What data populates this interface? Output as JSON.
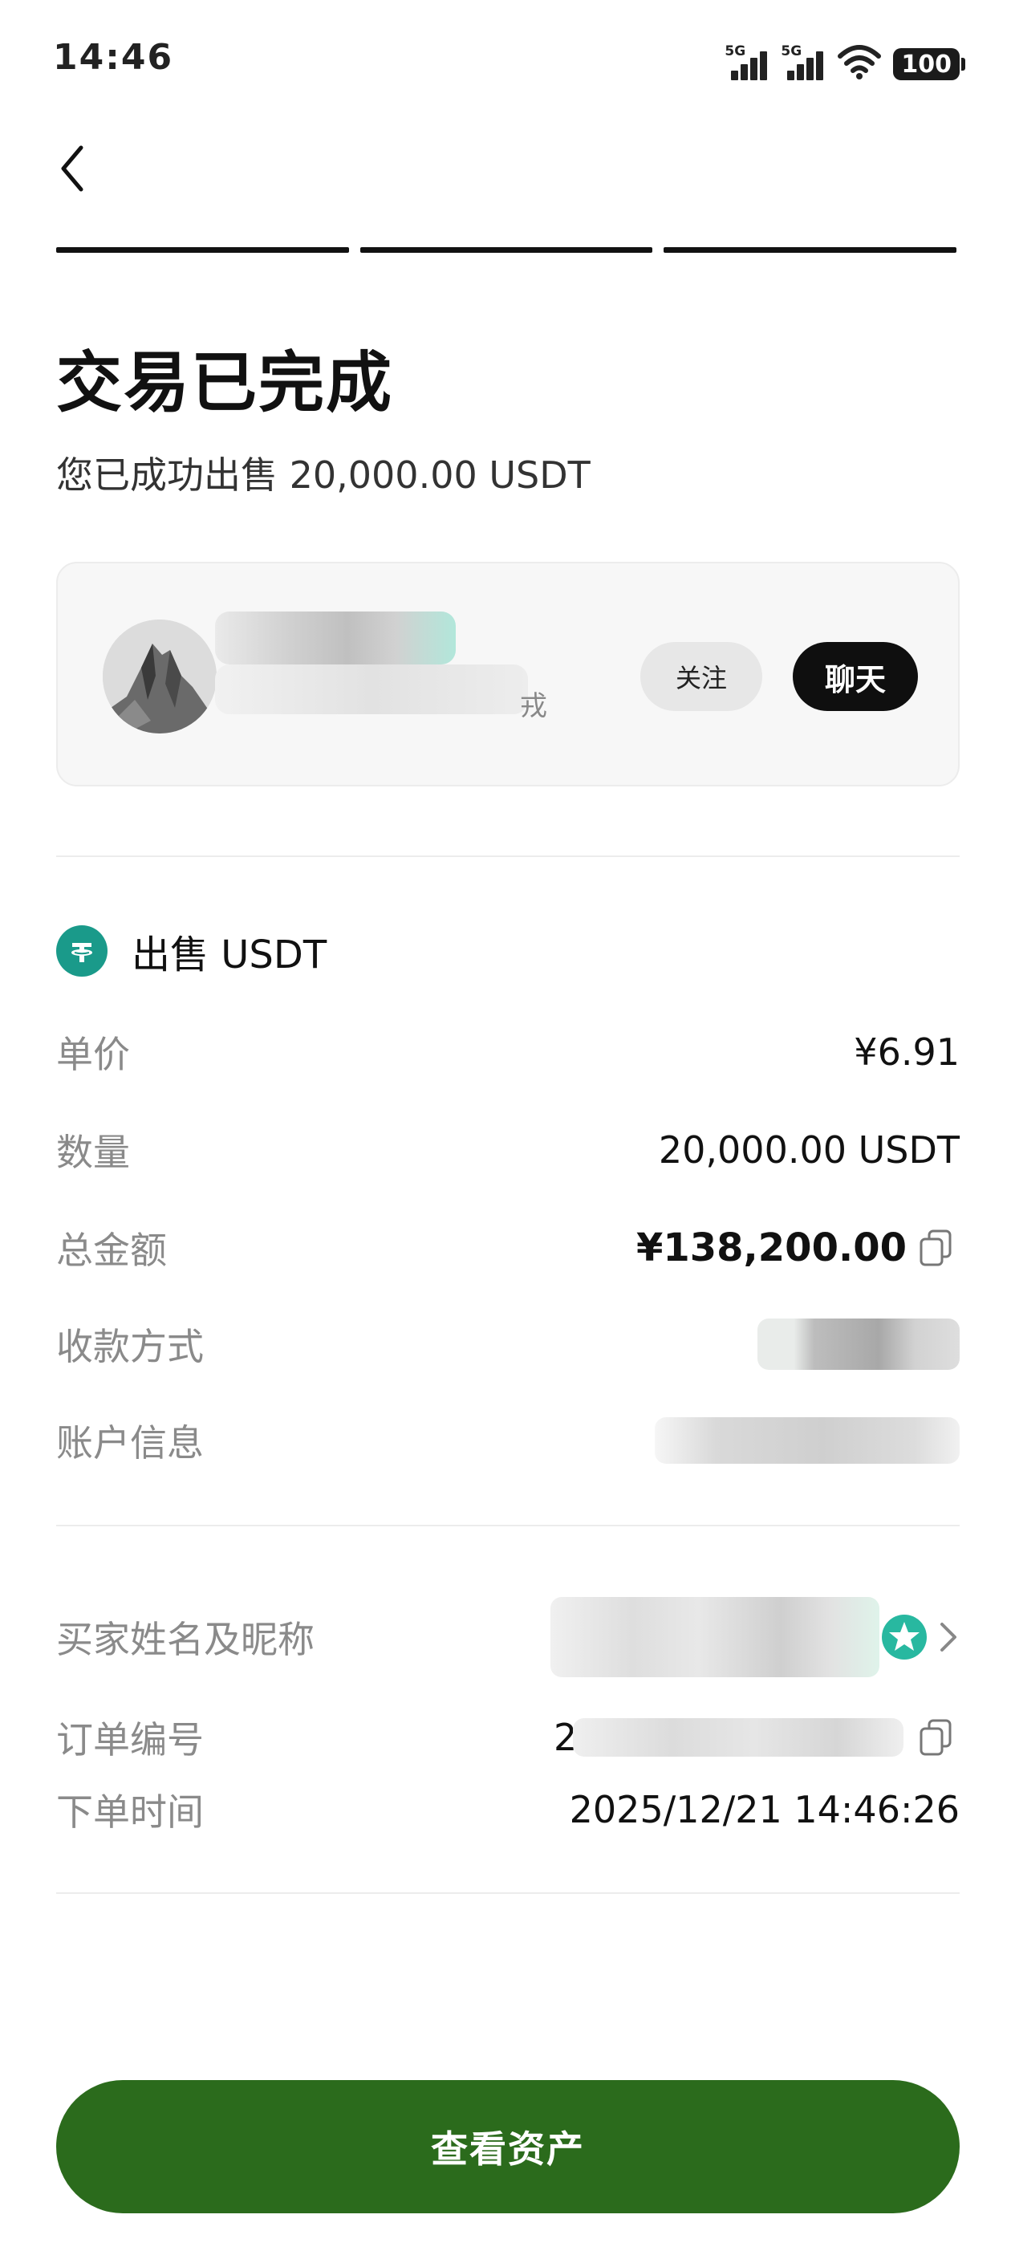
{
  "status_bar": {
    "time": "14:46",
    "signal_1_label": "5G",
    "signal_2_label": "5G",
    "battery": "100"
  },
  "header": {
    "progress_steps": 3,
    "back_icon": "chevron-left-icon"
  },
  "title": "交易已完成",
  "subtitle": "您已成功出售 20,000.00 USDT",
  "counterparty": {
    "name_suffix": "戎",
    "follow_label": "关注",
    "chat_label": "聊天"
  },
  "order": {
    "section_title": "出售 USDT",
    "coin_icon": "tether-icon",
    "coin_color": "#1a9a8a",
    "price_label": "单价",
    "price_value": "¥6.91",
    "quantity_label": "数量",
    "quantity_value": "20,000.00 USDT",
    "total_label": "总金额",
    "total_value": "¥138,200.00",
    "payment_method_label": "收款方式",
    "account_info_label": "账户信息"
  },
  "buyer": {
    "name_label": "买家姓名及昵称",
    "order_number_label": "订单编号",
    "order_number_prefix": "2",
    "order_time_label": "下单时间",
    "order_time_value": "2025/12/21 14:46:26"
  },
  "cta_label": "查看资产",
  "colors": {
    "accent": "#2b6b1c",
    "badge": "#28b8a0"
  }
}
